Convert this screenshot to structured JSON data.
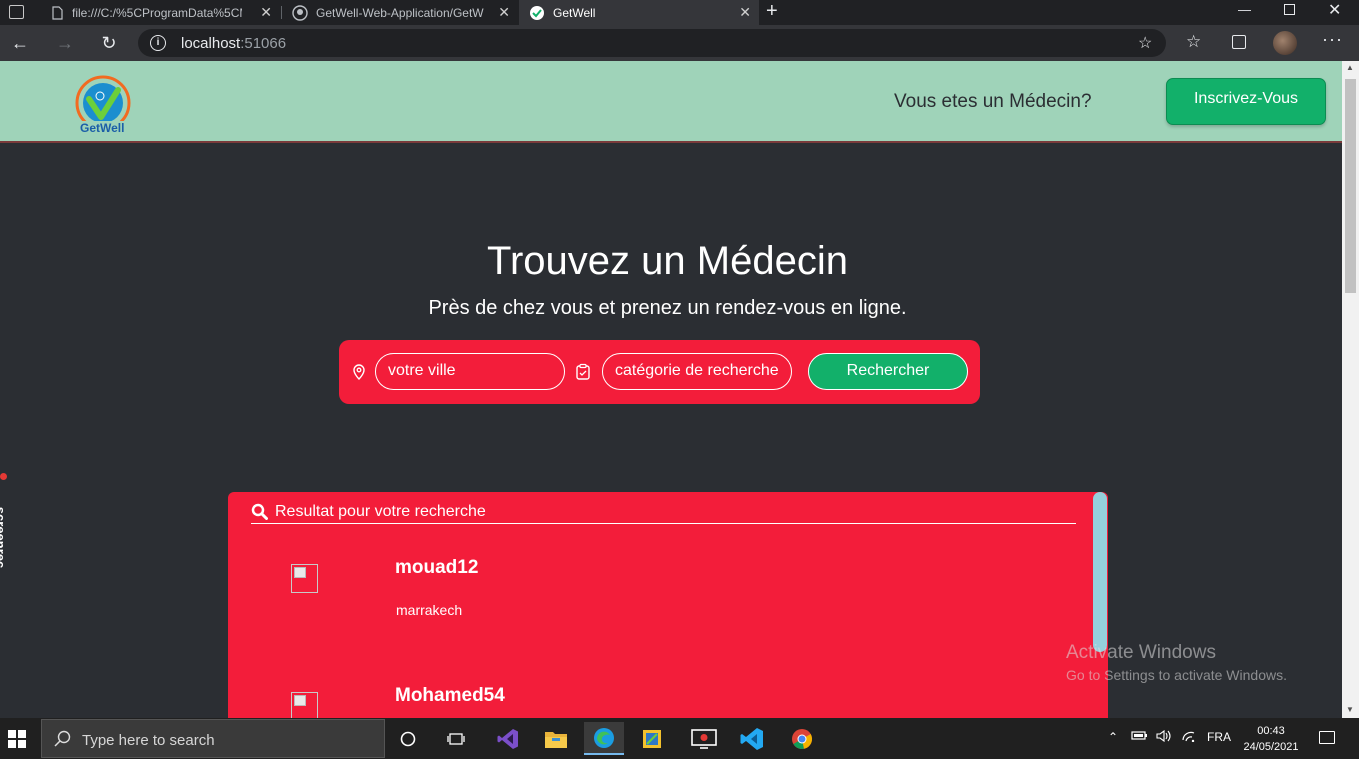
{
  "browser": {
    "tabs": [
      {
        "title": "file:///C:/%5CProgramData%5CM"
      },
      {
        "title": "GetWell-Web-Application/GetW"
      },
      {
        "title": "GetWell"
      }
    ],
    "address": {
      "host": "localhost",
      "port": ":51066"
    }
  },
  "header": {
    "logo_text": "GetWell",
    "doctor_question": "Vous etes un Médecin?",
    "signup_label": "Inscrivez-Vous"
  },
  "hero": {
    "title": "Trouvez un Médecin",
    "subtitle": "Près de chez vous et prenez un rendez-vous en ligne."
  },
  "search": {
    "city_placeholder": "votre ville",
    "category_placeholder": "catégorie de recherche",
    "button_label": "Rechercher"
  },
  "results": {
    "heading": "Resultat pour votre recherche",
    "doctors": [
      {
        "name": "mouad12",
        "city": "marrakech"
      },
      {
        "name": "Mohamed54",
        "city": ""
      }
    ]
  },
  "overlay": {
    "screenrec_label": "screenrec",
    "activate_title": "Activate Windows",
    "activate_sub": "Go to Settings to activate Windows."
  },
  "taskbar": {
    "search_placeholder": "Type here to search",
    "language": "FRA",
    "time": "00:43",
    "date": "24/05/2021"
  },
  "colors": {
    "header_bg": "#9fd3b9",
    "accent_red": "#f31d3a",
    "accent_green": "#12b06a",
    "page_bg": "#2b2e33"
  }
}
